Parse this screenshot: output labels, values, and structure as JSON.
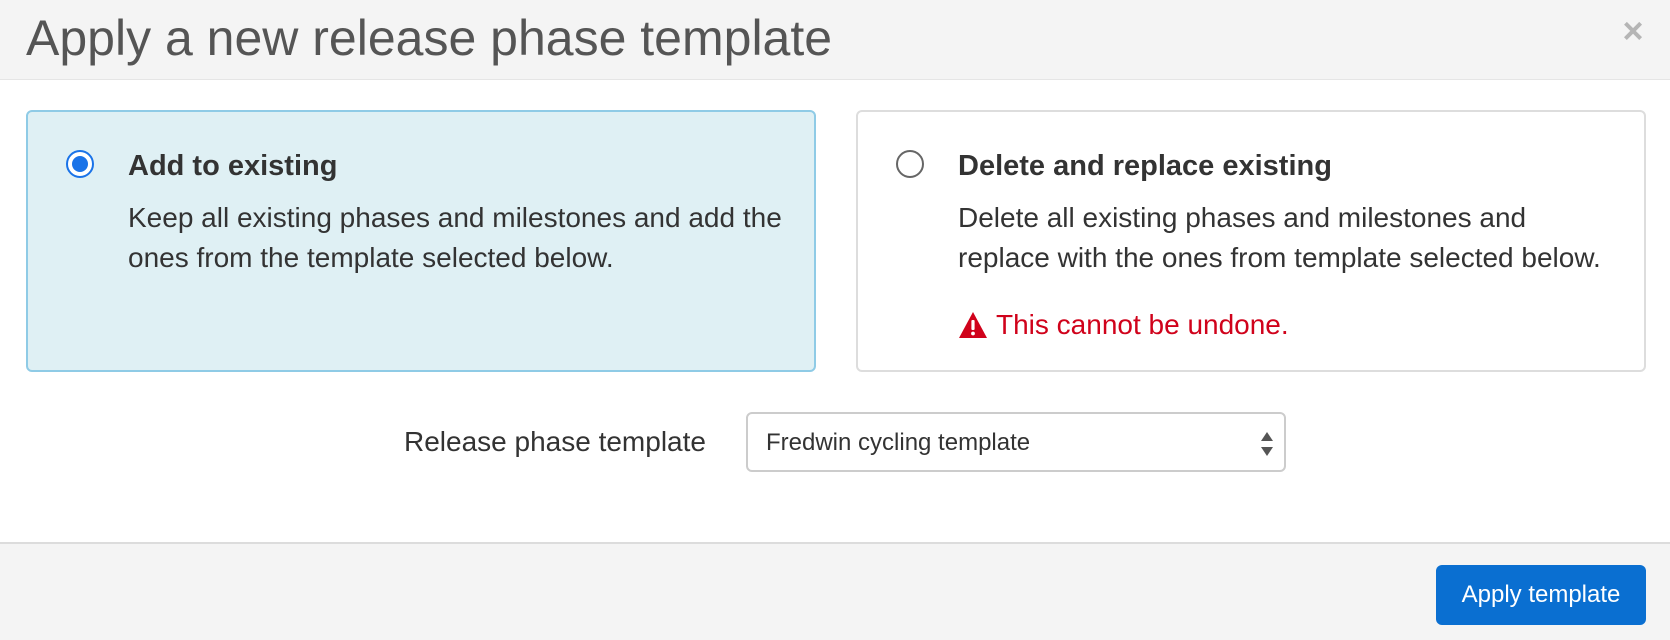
{
  "dialog": {
    "title": "Apply a new release phase template",
    "close_icon": "×"
  },
  "options": [
    {
      "title": "Add to existing",
      "description": "Keep all existing phases and milestones and add the ones from the template selected below.",
      "selected": true
    },
    {
      "title": "Delete and replace existing",
      "description": "Delete all existing phases and milestones and replace with the ones from template selected below.",
      "selected": false,
      "warning": "This cannot be undone."
    }
  ],
  "template_field": {
    "label": "Release phase template",
    "value": "Fredwin cycling template"
  },
  "footer": {
    "apply_label": "Apply template"
  },
  "colors": {
    "accent": "#0a6fd1",
    "selected_bg": "#dff0f4",
    "selected_border": "#8fcbe6",
    "warning": "#d0021b"
  }
}
